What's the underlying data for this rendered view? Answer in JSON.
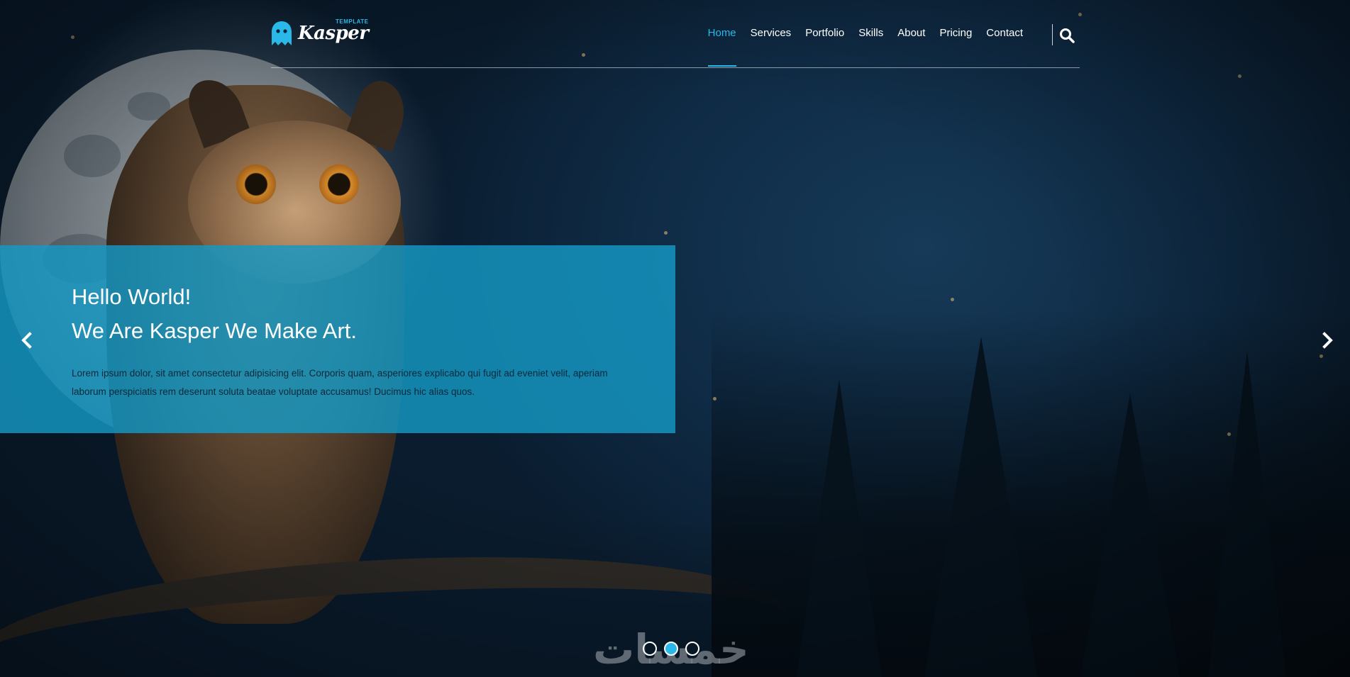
{
  "brand": {
    "name": "Kasper",
    "tag": "TEMPLATE",
    "accent_color": "#2ab8e8",
    "logo_icon": "ghost-icon"
  },
  "nav": {
    "items": [
      {
        "label": "Home",
        "active": true
      },
      {
        "label": "Services",
        "active": false
      },
      {
        "label": "Portfolio",
        "active": false
      },
      {
        "label": "Skills",
        "active": false
      },
      {
        "label": "About",
        "active": false
      },
      {
        "label": "Pricing",
        "active": false
      },
      {
        "label": "Contact",
        "active": false
      }
    ],
    "search_icon": "search-icon"
  },
  "slide": {
    "title_line1": "Hello World!",
    "title_line2": "We Are Kasper We Make Art.",
    "description": "Lorem ipsum dolor, sit amet consectetur adipisicing elit. Corporis quam, asperiores explicabo qui fugit ad eveniet velit, aperiam laborum perspiciatis rem deserunt soluta beatae voluptate accusamus! Ducimus hic alias quos.",
    "panel_color": "#1598c5",
    "prev_icon": "chevron-left-icon",
    "next_icon": "chevron-right-icon"
  },
  "slider_dots": {
    "count": 3,
    "active_index": 1
  },
  "watermark": "خمسات"
}
